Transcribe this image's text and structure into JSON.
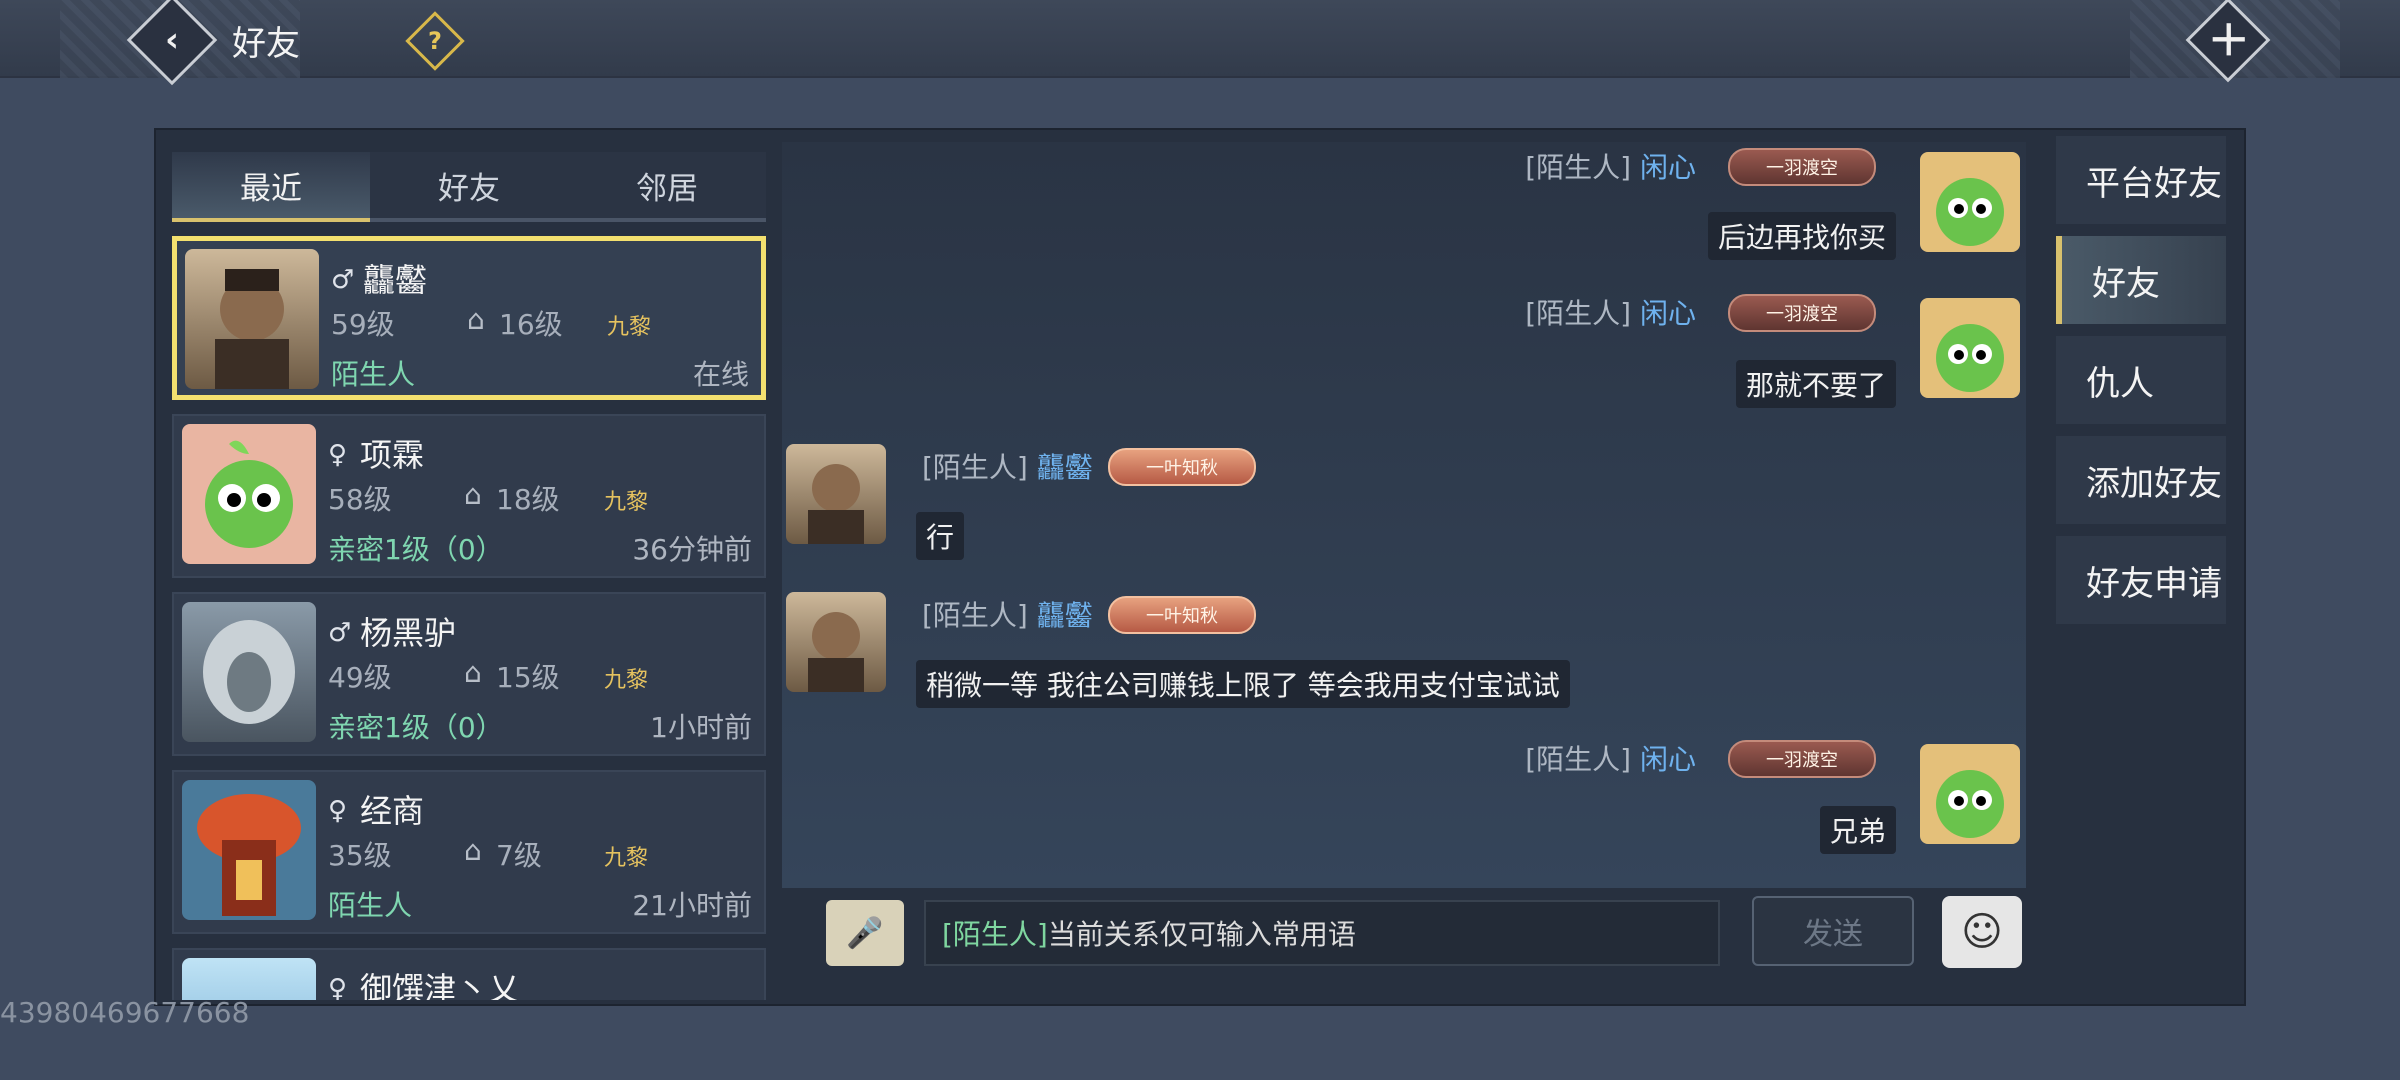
{
  "header": {
    "title": "好友",
    "back_icon": "chevron-left-icon",
    "help_icon": "question-icon",
    "close_icon": "close-icon"
  },
  "tabs": [
    {
      "label": "最近"
    },
    {
      "label": "好友"
    },
    {
      "label": "邻居"
    }
  ],
  "friends": [
    {
      "name": "龘齾",
      "gender_icon": "male-icon",
      "level": "59级",
      "sub_level": "16级",
      "guild": "九黎",
      "relation": "陌生人",
      "status": "在线"
    },
    {
      "name": "项霖",
      "gender_icon": "female-icon",
      "level": "58级",
      "sub_level": "18级",
      "guild": "九黎",
      "relation": "亲密1级（0）",
      "status": "36分钟前"
    },
    {
      "name": "杨黑驴",
      "gender_icon": "male-icon",
      "level": "49级",
      "sub_level": "15级",
      "guild": "九黎",
      "relation": "亲密1级（0）",
      "status": "1小时前"
    },
    {
      "name": "经商",
      "gender_icon": "female-icon",
      "level": "35级",
      "sub_level": "7级",
      "guild": "九黎",
      "relation": "陌生人",
      "status": "21小时前"
    },
    {
      "name": "御馔津丶乂",
      "gender_icon": "female-icon"
    }
  ],
  "messages": [
    {
      "side": "right",
      "tag": "[陌生人]",
      "sender": "闲心",
      "badge": "一羽渡空",
      "text": "后边再找你买"
    },
    {
      "side": "right",
      "tag": "[陌生人]",
      "sender": "闲心",
      "badge": "一羽渡空",
      "text": "那就不要了"
    },
    {
      "side": "left",
      "tag": "[陌生人]",
      "sender": "龘齾",
      "badge": "一叶知秋",
      "text": "行"
    },
    {
      "side": "left",
      "tag": "[陌生人]",
      "sender": "龘齾",
      "badge": "一叶知秋",
      "text": "稍微一等 我往公司赚钱上限了  等会我用支付宝试试"
    },
    {
      "side": "right",
      "tag": "[陌生人]",
      "sender": "闲心",
      "badge": "一羽渡空",
      "text": "兄弟"
    }
  ],
  "side_tabs": [
    {
      "label": "平台好友"
    },
    {
      "label": "好友"
    },
    {
      "label": "仇人"
    },
    {
      "label": "添加好友"
    },
    {
      "label": "好友申请"
    }
  ],
  "input": {
    "tag": "[陌生人]",
    "placeholder": "当前关系仅可输入常用语",
    "send_label": "发送",
    "voice_icon": "microphone-icon",
    "emoji_icon": "smiley-icon"
  },
  "uid": "43980469677668"
}
